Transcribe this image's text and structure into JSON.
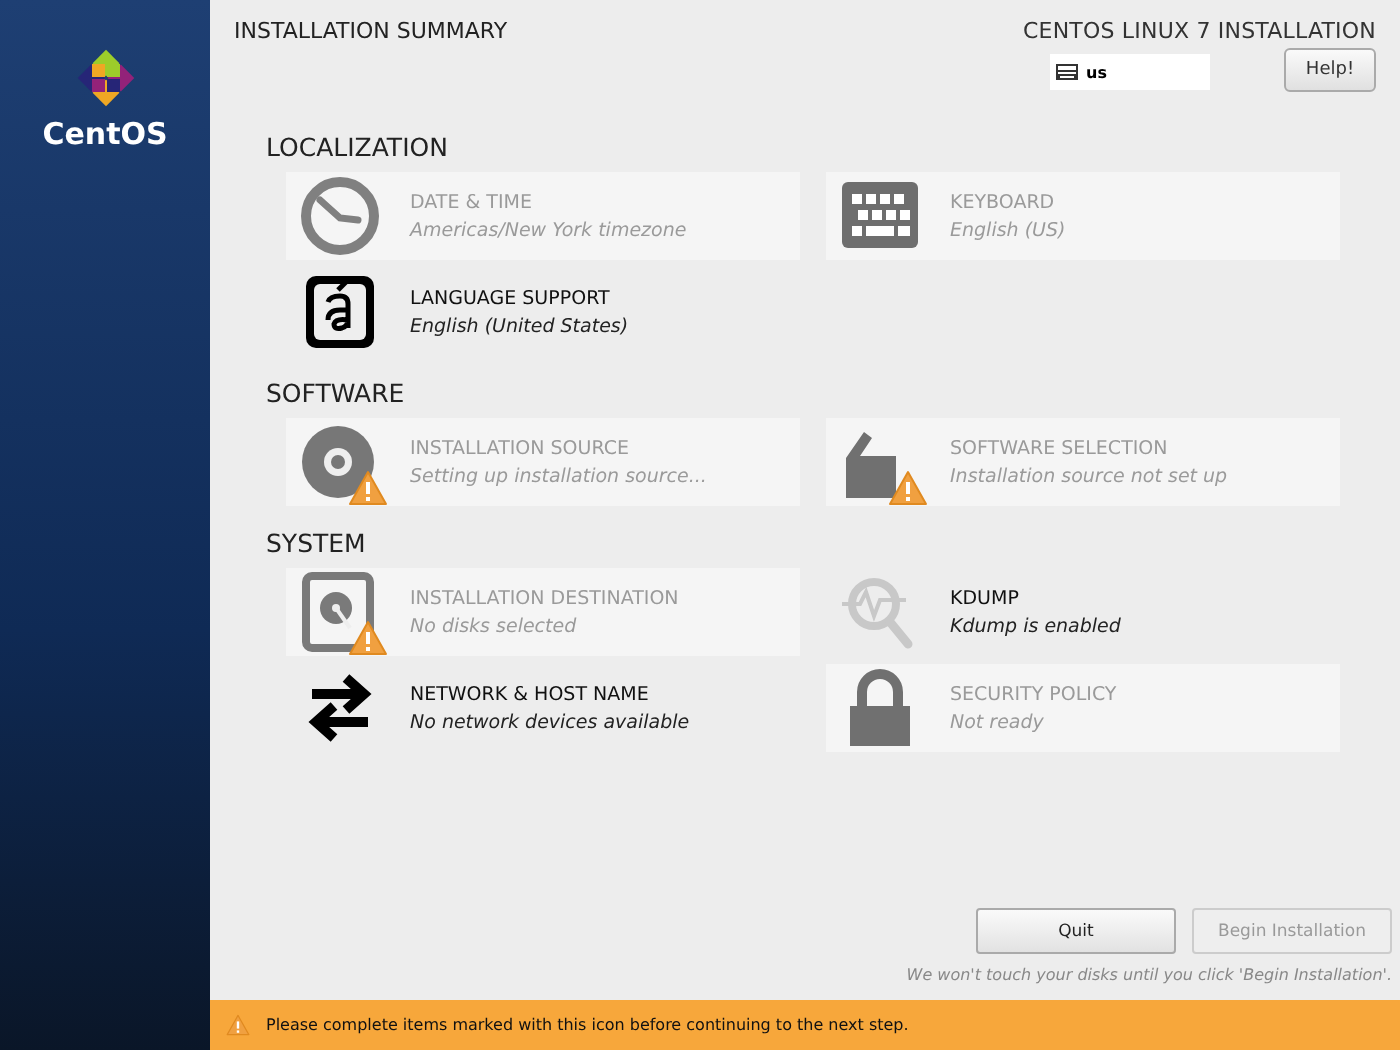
{
  "sidebar": {
    "logo_text": "CentOS"
  },
  "header": {
    "title": "INSTALLATION SUMMARY",
    "product": "CENTOS LINUX 7 INSTALLATION",
    "keyboard_layout": "us",
    "help_button": "Help!"
  },
  "sections": [
    {
      "title": "LOCALIZATION",
      "spokes": [
        {
          "kind": "clock",
          "title": "DATE & TIME",
          "status": "Americas/New York timezone",
          "disabled": true,
          "warning": false
        },
        {
          "kind": "keyboard",
          "title": "KEYBOARD",
          "status": "English (US)",
          "disabled": true,
          "warning": false
        },
        {
          "kind": "language",
          "title": "LANGUAGE SUPPORT",
          "status": "English (United States)",
          "disabled": false,
          "warning": false
        }
      ]
    },
    {
      "title": "SOFTWARE",
      "spokes": [
        {
          "kind": "disc",
          "title": "INSTALLATION SOURCE",
          "status": "Setting up installation source...",
          "disabled": true,
          "warning": true
        },
        {
          "kind": "package",
          "title": "SOFTWARE SELECTION",
          "status": "Installation source not set up",
          "disabled": true,
          "warning": true
        }
      ]
    },
    {
      "title": "SYSTEM",
      "spokes": [
        {
          "kind": "disk",
          "title": "INSTALLATION DESTINATION",
          "status": "No disks selected",
          "disabled": true,
          "warning": true
        },
        {
          "kind": "search",
          "title": "KDUMP",
          "status": "Kdump is enabled",
          "disabled": false,
          "warning": false
        },
        {
          "kind": "network",
          "title": "NETWORK & HOST NAME",
          "status": "No network devices available",
          "disabled": false,
          "warning": false
        },
        {
          "kind": "lock",
          "title": "SECURITY POLICY",
          "status": "Not ready",
          "disabled": true,
          "warning": false
        }
      ]
    }
  ],
  "footer": {
    "buttons": [
      {
        "label": "Quit",
        "disabled": false
      },
      {
        "label": "Begin Installation",
        "disabled": true
      }
    ],
    "note": "We won't touch your disks until you click 'Begin Installation'."
  },
  "warning_bar": {
    "message": "Please complete items marked with this icon before continuing to the next step."
  }
}
